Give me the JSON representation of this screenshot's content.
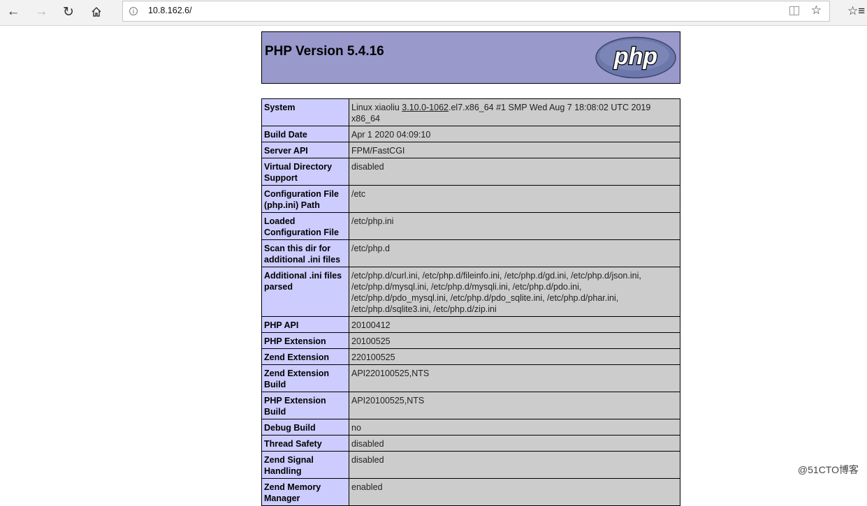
{
  "browser": {
    "url": "10.8.162.6/",
    "nav": {
      "back_icon": "arrow-left-icon",
      "forward_icon": "arrow-right-icon",
      "refresh_icon": "refresh-icon",
      "home_icon": "home-icon"
    },
    "address_icons": [
      "info-icon",
      "reading-view-icon",
      "favorite-star-icon"
    ],
    "favorites_icon": "favorites-hub-icon"
  },
  "colors": {
    "header_bg": "#9999cc",
    "key_bg": "#ccccff",
    "value_bg": "#cccccc"
  },
  "page": {
    "title": "PHP Version 5.4.16",
    "logo_text": "php",
    "rows": [
      {
        "label": "System",
        "value_pre": "Linux xiaoliu ",
        "value_link": "3.10.0-1062",
        "value_post": ".el7.x86_64 #1 SMP Wed Aug 7 18:08:02 UTC 2019 x86_64"
      },
      {
        "label": "Build Date",
        "value": "Apr 1 2020 04:09:10"
      },
      {
        "label": "Server API",
        "value": "FPM/FastCGI"
      },
      {
        "label": "Virtual Directory Support",
        "value": "disabled"
      },
      {
        "label": "Configuration File (php.ini) Path",
        "value": "/etc"
      },
      {
        "label": "Loaded Configuration File",
        "value": "/etc/php.ini"
      },
      {
        "label": "Scan this dir for additional .ini files",
        "value": "/etc/php.d"
      },
      {
        "label": "Additional .ini files parsed",
        "value": "/etc/php.d/curl.ini, /etc/php.d/fileinfo.ini, /etc/php.d/gd.ini, /etc/php.d/json.ini, /etc/php.d/mysql.ini, /etc/php.d/mysqli.ini, /etc/php.d/pdo.ini, /etc/php.d/pdo_mysql.ini, /etc/php.d/pdo_sqlite.ini, /etc/php.d/phar.ini, /etc/php.d/sqlite3.ini, /etc/php.d/zip.ini"
      },
      {
        "label": "PHP API",
        "value": "20100412"
      },
      {
        "label": "PHP Extension",
        "value": "20100525"
      },
      {
        "label": "Zend Extension",
        "value": "220100525"
      },
      {
        "label": "Zend Extension Build",
        "value": "API220100525,NTS"
      },
      {
        "label": "PHP Extension Build",
        "value": "API20100525,NTS"
      },
      {
        "label": "Debug Build",
        "value": "no"
      },
      {
        "label": "Thread Safety",
        "value": "disabled"
      },
      {
        "label": "Zend Signal Handling",
        "value": "disabled"
      },
      {
        "label": "Zend Memory Manager",
        "value": "enabled"
      }
    ]
  },
  "watermark": "@51CTO博客"
}
